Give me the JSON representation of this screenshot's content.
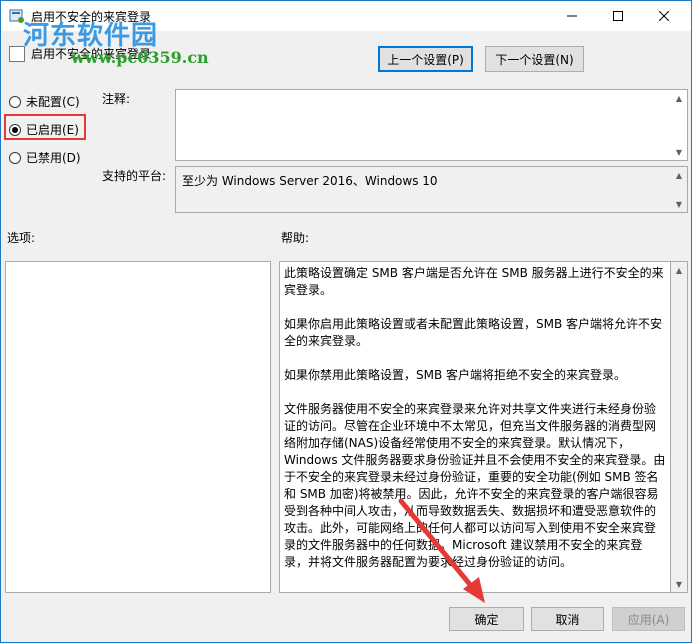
{
  "window": {
    "title": "启用不安全的来宾登录",
    "policy_name": "启用不安全的来宾登录"
  },
  "watermark": {
    "site": "河东软件园",
    "url": "www.pc0359.cn"
  },
  "nav": {
    "prev": "上一个设置(P)",
    "next": "下一个设置(N)"
  },
  "state": {
    "options": [
      {
        "label": "未配置(C)",
        "selected": false
      },
      {
        "label": "已启用(E)",
        "selected": true
      },
      {
        "label": "已禁用(D)",
        "selected": false
      }
    ]
  },
  "labels": {
    "comment": "注释:",
    "platform": "支持的平台:",
    "options": "选项:",
    "help": "帮助:"
  },
  "platform_value": "至少为 Windows Server 2016、Windows 10",
  "help_paragraphs": [
    "此策略设置确定 SMB 客户端是否允许在 SMB 服务器上进行不安全的来宾登录。",
    "如果你启用此策略设置或者未配置此策略设置，SMB 客户端将允许不安全的来宾登录。",
    "如果你禁用此策略设置，SMB 客户端将拒绝不安全的来宾登录。",
    "文件服务器使用不安全的来宾登录来允许对共享文件夹进行未经身份验证的访问。尽管在企业环境中不太常见，但充当文件服务器的消费型网络附加存储(NAS)设备经常使用不安全的来宾登录。默认情况下，Windows 文件服务器要求身份验证并且不会使用不安全的来宾登录。由于不安全的来宾登录未经过身份验证，重要的安全功能(例如 SMB 签名和 SMB 加密)将被禁用。因此，允许不安全的来宾登录的客户端很容易受到各种中间人攻击，从而导致数据丢失、数据损坏和遭受恶意软件的攻击。此外，可能网络上的任何人都可以访问写入到使用不安全来宾登录的文件服务器中的任何数据。Microsoft 建议禁用不安全的来宾登录，并将文件服务器配置为要求经过身份验证的访问。"
  ],
  "footer": {
    "ok": "确定",
    "cancel": "取消",
    "apply": "应用(A)"
  },
  "colors": {
    "accent": "#0078d7",
    "highlight": "#e53935",
    "watermark_blue": "#1a8be0",
    "watermark_green": "#2aa02a"
  }
}
